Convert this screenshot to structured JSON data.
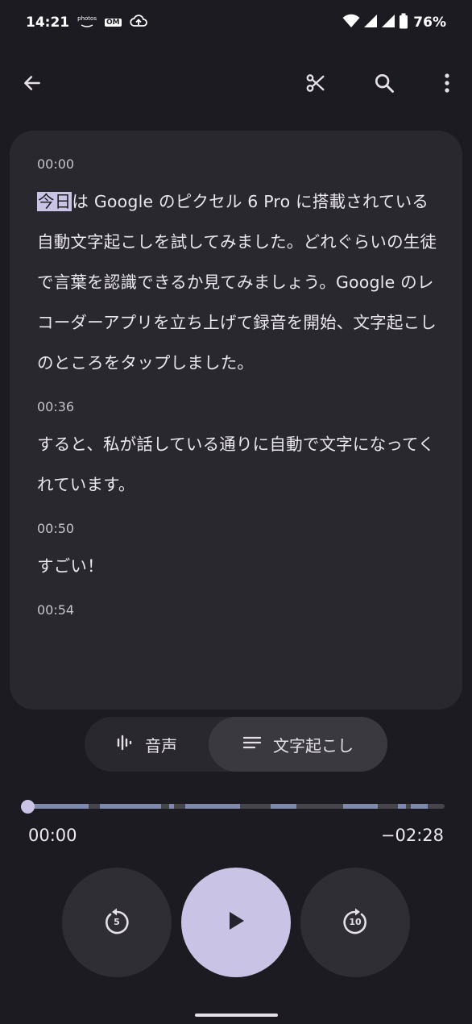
{
  "status_bar": {
    "time": "14:21",
    "photos_label": "photos",
    "om_label": "OM",
    "battery": "76%"
  },
  "app_bar": {
    "back_icon": "arrow-left-icon",
    "trim_icon": "scissors-icon",
    "search_icon": "search-icon",
    "more_icon": "more-vert-icon"
  },
  "transcript": {
    "segments": [
      {
        "time": "00:00",
        "highlight": "今日",
        "text": "は Google のピクセル 6 Pro に搭載されている自動文字起こしを試してみました。どれぐらいの生徒で言葉を認識できるか見てみましょう。Google のレコーダーアプリを立ち上げて録音を開始、文字起こしのところをタップしました。"
      },
      {
        "time": "00:36",
        "text": "すると、私が話している通りに自動で文字になってくれています。"
      },
      {
        "time": "00:50",
        "text": "すごい！"
      },
      {
        "time": "00:54",
        "text": ""
      }
    ]
  },
  "toggle": {
    "audio_label": "音声",
    "transcript_label": "文字起こし",
    "selected": "transcript"
  },
  "player": {
    "current_time": "00:00",
    "remaining_time": "−02:28",
    "progress": 0,
    "rewind_label": "5",
    "forward_label": "10"
  },
  "colors": {
    "background": "#1c1b21",
    "card": "#29282e",
    "accent": "#c9c4e6",
    "speech_segments": "#7d89ad"
  }
}
